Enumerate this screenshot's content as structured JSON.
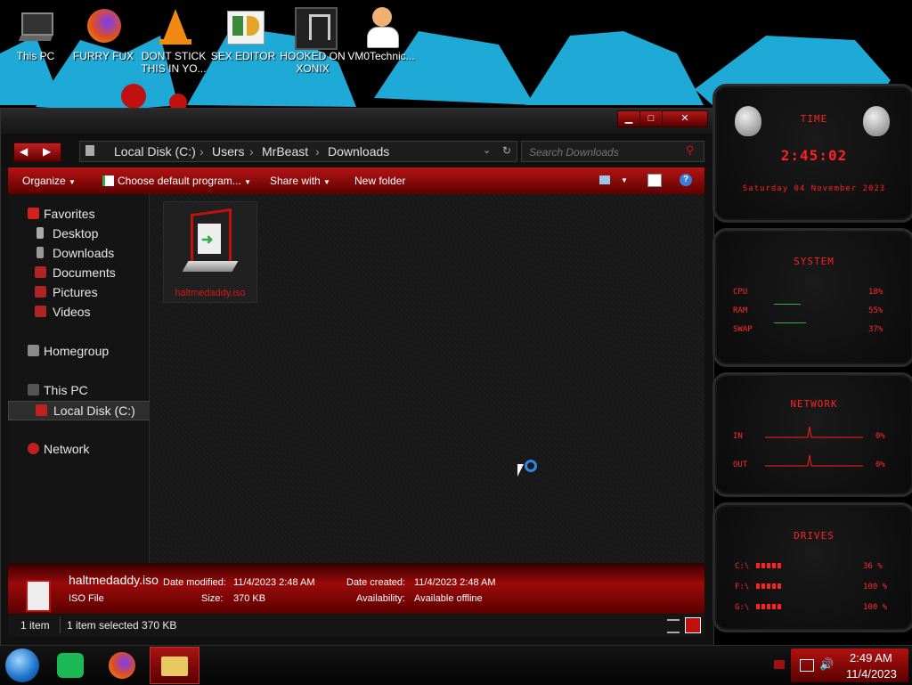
{
  "desktop": {
    "icons": [
      {
        "label": "This PC",
        "icon": "computer-icon"
      },
      {
        "label": "FURRY FUX",
        "icon": "firefox-icon"
      },
      {
        "label": "DONT STICK THIS IN YO...",
        "icon": "vlc-cone-icon"
      },
      {
        "label": "SEX EDITOR",
        "icon": "hex-editor-icon"
      },
      {
        "label": "HOOKED ON XONIX",
        "icon": "game-icon"
      },
      {
        "label": "VM0Technic...",
        "icon": "doctor-icon"
      }
    ]
  },
  "window": {
    "address": {
      "segments": [
        "Local Disk (C:)",
        "Users",
        "MrBeast",
        "Downloads"
      ]
    },
    "search": {
      "placeholder": "Search Downloads"
    },
    "toolbar": {
      "organize": "Organize",
      "choose_default": "Choose default program...",
      "share_with": "Share with",
      "new_folder": "New folder"
    },
    "nav": {
      "favorites": "Favorites",
      "desktop": "Desktop",
      "downloads": "Downloads",
      "documents": "Documents",
      "pictures": "Pictures",
      "videos": "Videos",
      "homegroup": "Homegroup",
      "this_pc": "This PC",
      "local_disk": "Local Disk (C:)",
      "network": "Network"
    },
    "file": {
      "name": "haltmedaddy.iso"
    },
    "details": {
      "name": "haltmedaddy.iso",
      "type": "ISO File",
      "date_modified_label": "Date modified:",
      "date_modified": "11/4/2023 2:48 AM",
      "date_created_label": "Date created:",
      "date_created": "11/4/2023 2:48 AM",
      "size_label": "Size:",
      "size": "370 KB",
      "availability_label": "Availability:",
      "availability": "Available offline"
    },
    "status": {
      "count": "1 item",
      "selection": "1 item selected  370 KB"
    }
  },
  "gadgets": {
    "time": {
      "title": "TIME",
      "clock": "2:45:02",
      "date": "Saturday 04 November 2023"
    },
    "system": {
      "title": "SYSTEM",
      "rows": [
        {
          "label": "CPU",
          "value": "18%"
        },
        {
          "label": "RAM",
          "value": "55%"
        },
        {
          "label": "SWAP",
          "value": "37%"
        }
      ]
    },
    "network": {
      "title": "NETWORK",
      "rows": [
        {
          "label": "IN",
          "value": "0%"
        },
        {
          "label": "OUT",
          "value": "0%"
        }
      ]
    },
    "drives": {
      "title": "DRIVES",
      "rows": [
        {
          "label": "C:\\",
          "value": "36 %"
        },
        {
          "label": "F:\\",
          "value": "100 %"
        },
        {
          "label": "G:\\",
          "value": "100 %"
        }
      ]
    }
  },
  "taskbar": {
    "clock_time": "2:49 AM",
    "clock_date": "11/4/2023"
  },
  "colors": {
    "accent": "#b01414",
    "gadget_text": "#ff2b2b",
    "wallpaper_blue": "#1ea9d6"
  }
}
